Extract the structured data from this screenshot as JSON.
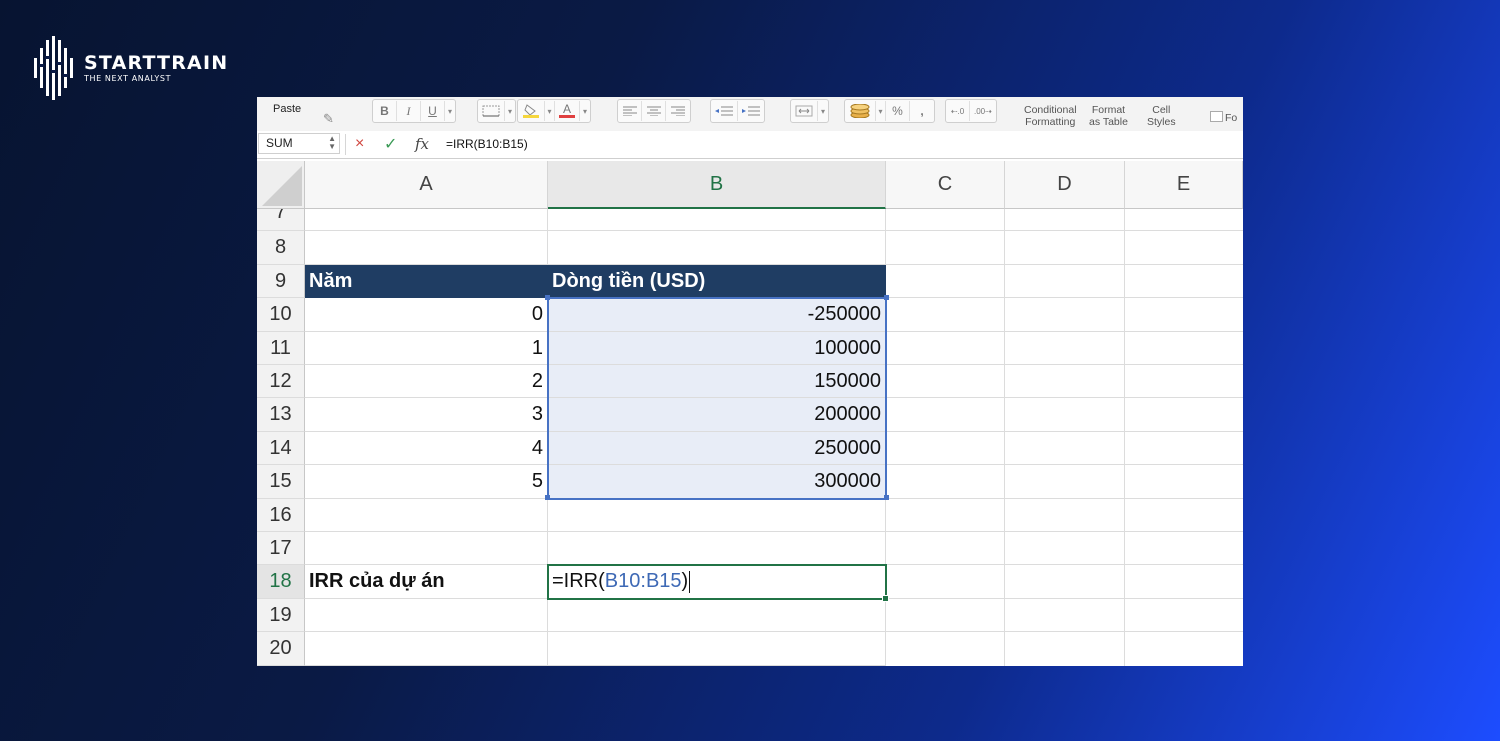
{
  "brand": {
    "name": "STARTTRAIN",
    "tagline": "THE NEXT ANALYST"
  },
  "ribbon": {
    "paste_label": "Paste",
    "bold": "B",
    "italic": "I",
    "underline": "U",
    "font_color_glyph": "A",
    "percent": "%",
    "comma": ",",
    "conditional_formatting": [
      "Conditional",
      "Formatting"
    ],
    "format_as_table": [
      "Format",
      "as Table"
    ],
    "cell_styles": [
      "Cell",
      "Styles"
    ],
    "fo_label": "Fo"
  },
  "formula_bar": {
    "name_box": "SUM",
    "cancel_icon": "×",
    "enter_icon": "✓",
    "fx_label": "fx",
    "formula": "=IRR(B10:B15)"
  },
  "columns": [
    "A",
    "B",
    "C",
    "D",
    "E"
  ],
  "active_column": "B",
  "rows": [
    "7",
    "8",
    "9",
    "10",
    "11",
    "12",
    "13",
    "14",
    "15",
    "16",
    "17",
    "18",
    "19",
    "20"
  ],
  "active_row": "18",
  "table": {
    "header_a": "Năm",
    "header_b": "Dòng tiền (USD)",
    "years": [
      "0",
      "1",
      "2",
      "3",
      "4",
      "5"
    ],
    "cash_flows": [
      "-250000",
      "100000",
      "150000",
      "200000",
      "250000",
      "300000"
    ]
  },
  "irr_row": {
    "label": "IRR của dự án",
    "formula_prefix": "=IRR(",
    "formula_ref": "B10:B15",
    "formula_suffix": ")"
  },
  "colors": {
    "header_fill": "#1f3d63",
    "selection_fill": "#e8edf7",
    "selection_border": "#4772c4",
    "active_border": "#217346",
    "reference_text": "#3e69b5"
  }
}
